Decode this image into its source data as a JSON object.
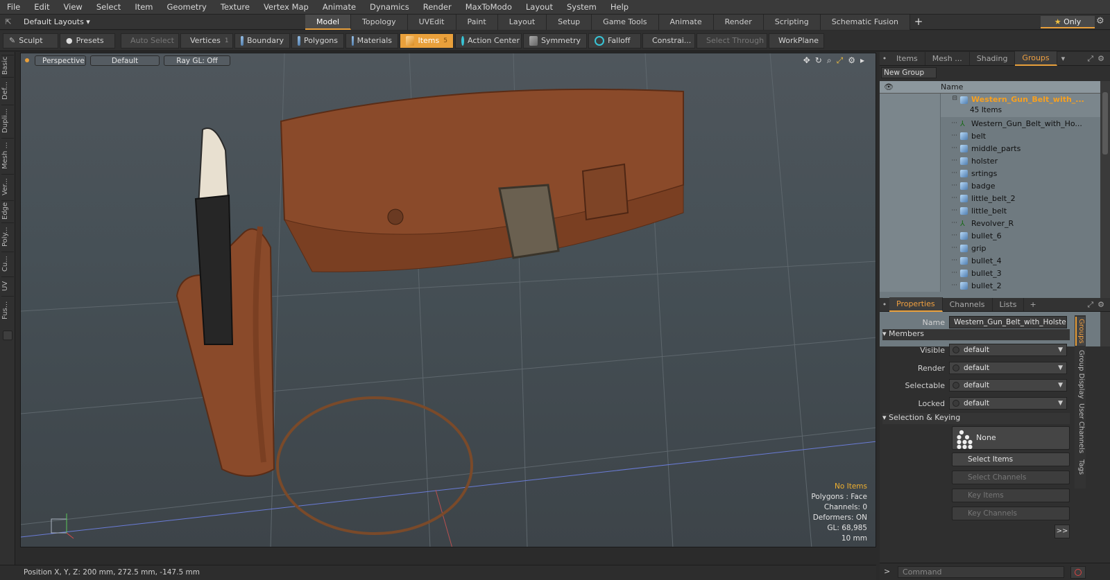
{
  "menu": [
    "File",
    "Edit",
    "View",
    "Select",
    "Item",
    "Geometry",
    "Texture",
    "Vertex Map",
    "Animate",
    "Dynamics",
    "Render",
    "MaxToModo",
    "Layout",
    "System",
    "Help"
  ],
  "layout": {
    "dropdown": "Default Layouts ▾",
    "tabs": [
      "Model",
      "Topology",
      "UVEdit",
      "Paint",
      "Layout",
      "Setup",
      "Game Tools",
      "Animate",
      "Render",
      "Scripting",
      "Schematic Fusion"
    ],
    "active_tab": "Model",
    "only": "Only"
  },
  "toolbar": {
    "sculpt": "Sculpt",
    "presets": "Presets",
    "auto_select": "Auto Select",
    "vertices": "Vertices",
    "vertices_count": "1",
    "boundary": "Boundary",
    "polygons": "Polygons",
    "materials": "Materials",
    "items": "Items",
    "items_count": "5",
    "action_center": "Action Center",
    "symmetry": "Symmetry",
    "falloff": "Falloff",
    "constraints": "Constrai...",
    "select_through": "Select Through",
    "workplane": "WorkPlane"
  },
  "left_tabs": [
    "Basic",
    "Def...",
    "Dupli...",
    "Mesh ...",
    "Ver...",
    "Edge",
    "Poly...",
    "Cu...",
    "UV",
    "Fus..."
  ],
  "viewport": {
    "perspective": "Perspective",
    "default": "Default",
    "raygl": "Ray GL: Off",
    "info": {
      "no_items": "No Items",
      "polygons": "Polygons : Face",
      "channels": "Channels: 0",
      "deformers": "Deformers: ON",
      "gl": "GL: 68,985",
      "scale": "10 mm"
    }
  },
  "status": {
    "position": "Position X, Y, Z:  200 mm, 272.5 mm, -147.5 mm"
  },
  "groups_panel": {
    "tabs": [
      "Items",
      "Mesh ...",
      "Shading",
      "Groups"
    ],
    "active": "Groups",
    "new_group": "New Group",
    "col_name": "Name",
    "group_name": "Western_Gun_Belt_with_...",
    "group_count": "45 Items",
    "items": [
      {
        "name": "Western_Gun_Belt_with_Ho...",
        "type": "locator"
      },
      {
        "name": "belt",
        "type": "mesh"
      },
      {
        "name": "middle_parts",
        "type": "mesh"
      },
      {
        "name": "holster",
        "type": "mesh"
      },
      {
        "name": "srtings",
        "type": "mesh"
      },
      {
        "name": "badge",
        "type": "mesh"
      },
      {
        "name": "little_belt_2",
        "type": "mesh"
      },
      {
        "name": "little_belt",
        "type": "mesh"
      },
      {
        "name": "Revolver_R",
        "type": "locator"
      },
      {
        "name": "bullet_6",
        "type": "mesh"
      },
      {
        "name": "grip",
        "type": "mesh"
      },
      {
        "name": "bullet_4",
        "type": "mesh"
      },
      {
        "name": "bullet_3",
        "type": "mesh"
      },
      {
        "name": "bullet_2",
        "type": "mesh"
      }
    ]
  },
  "properties": {
    "tabs": [
      "Properties",
      "Channels",
      "Lists"
    ],
    "active": "Properties",
    "name_label": "Name",
    "name_value": "Western_Gun_Belt_with_Holster_",
    "members": "Members",
    "visible_label": "Visible",
    "visible": "default",
    "render_label": "Render",
    "render": "default",
    "selectable_label": "Selectable",
    "selectable": "default",
    "locked_label": "Locked",
    "locked": "default",
    "selection_keying": "Selection & Keying",
    "none": "None",
    "select_items": "Select Items",
    "select_channels": "Select Channels",
    "key_items": "Key Items",
    "key_channels": "Key Channels",
    "more": ">>",
    "side_tabs": [
      "Groups",
      "Group Display",
      "User Channels",
      "Tags"
    ]
  },
  "command": {
    "placeholder": "Command"
  }
}
